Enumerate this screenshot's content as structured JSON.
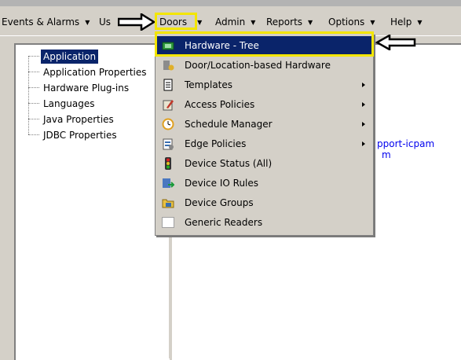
{
  "menubar": {
    "items": [
      {
        "label": "Events & Alarms",
        "has_arrow": true
      },
      {
        "label": "Us",
        "has_arrow": false
      },
      {
        "label": "Doors",
        "has_arrow": true
      },
      {
        "label": "Admin",
        "has_arrow": true
      },
      {
        "label": "Reports",
        "has_arrow": true
      },
      {
        "label": "Options",
        "has_arrow": true
      },
      {
        "label": "Help",
        "has_arrow": true
      }
    ]
  },
  "tree": {
    "items": [
      {
        "label": "Application",
        "selected": true
      },
      {
        "label": "Application Properties"
      },
      {
        "label": "Hardware Plug-ins"
      },
      {
        "label": "Languages"
      },
      {
        "label": "Java Properties"
      },
      {
        "label": "JDBC Properties"
      }
    ]
  },
  "content": {
    "link_line1": "pport-icpam",
    "link_line2": "m"
  },
  "dropdown": {
    "items": [
      {
        "label": "Hardware - Tree",
        "icon": "hardware-tree-icon",
        "submenu": false,
        "active": true
      },
      {
        "label": "Door/Location-based Hardware",
        "icon": "door-location-icon",
        "submenu": false
      },
      {
        "label": "Templates",
        "icon": "templates-icon",
        "submenu": true
      },
      {
        "label": "Access Policies",
        "icon": "access-policies-icon",
        "submenu": true
      },
      {
        "label": "Schedule Manager",
        "icon": "schedule-manager-icon",
        "submenu": true
      },
      {
        "label": "Edge Policies",
        "icon": "edge-policies-icon",
        "submenu": true
      },
      {
        "label": "Device Status (All)",
        "icon": "traffic-light-icon",
        "submenu": false
      },
      {
        "label": "Device IO Rules",
        "icon": "device-io-rules-icon",
        "submenu": false
      },
      {
        "label": "Device Groups",
        "icon": "device-groups-icon",
        "submenu": false
      },
      {
        "label": "Generic Readers",
        "icon": "generic-readers-icon",
        "submenu": false
      }
    ]
  },
  "colors": {
    "selection": "#0a246a",
    "callout": "#f3e600",
    "link": "#0000ee"
  }
}
